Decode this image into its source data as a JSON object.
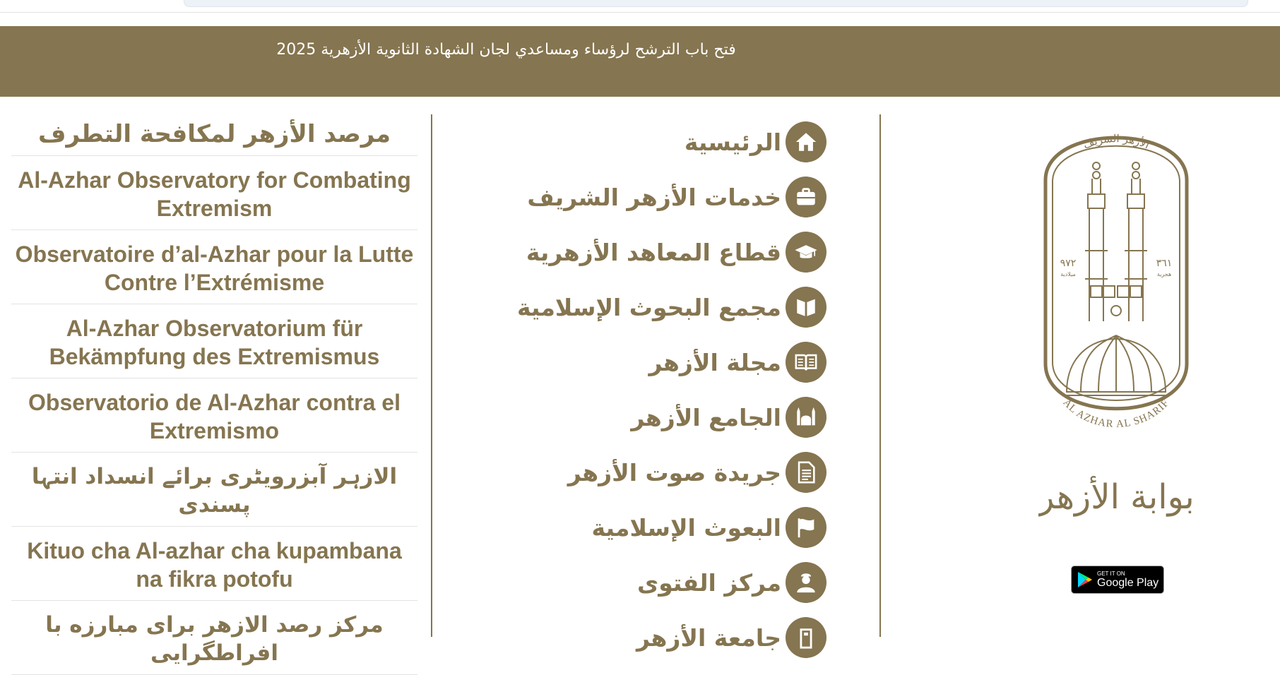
{
  "banner": {
    "announcement": "فتح باب الترشح لرؤساء ومساعدي لجان الشهادة الثانوية الأزهرية 2025"
  },
  "menu": {
    "items": [
      {
        "label": "الرئيسية",
        "icon": "home-icon"
      },
      {
        "label": "خدمات الأزهر الشريف",
        "icon": "briefcase-icon"
      },
      {
        "label": "قطاع المعاهد الأزهرية",
        "icon": "graduation-cap-icon"
      },
      {
        "label": "مجمع البحوث الإسلامية",
        "icon": "book-icon"
      },
      {
        "label": "مجلة الأزهر",
        "icon": "open-book-icon"
      },
      {
        "label": "الجامع الأزهر",
        "icon": "mosque-icon"
      },
      {
        "label": "جريدة صوت الأزهر",
        "icon": "document-icon"
      },
      {
        "label": "البعوث الإسلامية",
        "icon": "flag-icon"
      },
      {
        "label": "مركز الفتوى",
        "icon": "mufti-icon"
      },
      {
        "label": "جامعة الأزهر",
        "icon": "university-icon"
      }
    ]
  },
  "observatory": {
    "title": "مرصد الأزهر لمكافحة التطرف",
    "items": [
      "Al-Azhar Observatory for Combating Extremism",
      "Observatoire d’al-Azhar pour la Lutte Contre l’Extrémisme",
      "Al-Azhar Observatorium für Bekämpfung des Extremismus",
      "Observatorio de Al-Azhar contra el Extremismo",
      "الازہر آبزرویٹری برائے انسداد انتہا پسندی",
      "Kituo cha Al-azhar cha kupambana na fikra potofu",
      "مرکز رصد الازهر برای مبارزه با افراطگرایی"
    ]
  },
  "logo": {
    "arabic_arc": "الأزهر الشريف",
    "latin_arc": "AL AZHAR AL SHARIF",
    "year_hijri": "٣٦١",
    "hijri_label": "هجرية",
    "year_gregorian": "٩٧٢",
    "gregorian_label": "ميلادية",
    "portal_name": "بوابة الأزهر"
  },
  "store_badge": {
    "small_text": "GET IT ON",
    "big_text": "Google Play"
  },
  "colors": {
    "brand": "#857550",
    "banner_text": "#ffffff",
    "background": "#ffffff"
  }
}
